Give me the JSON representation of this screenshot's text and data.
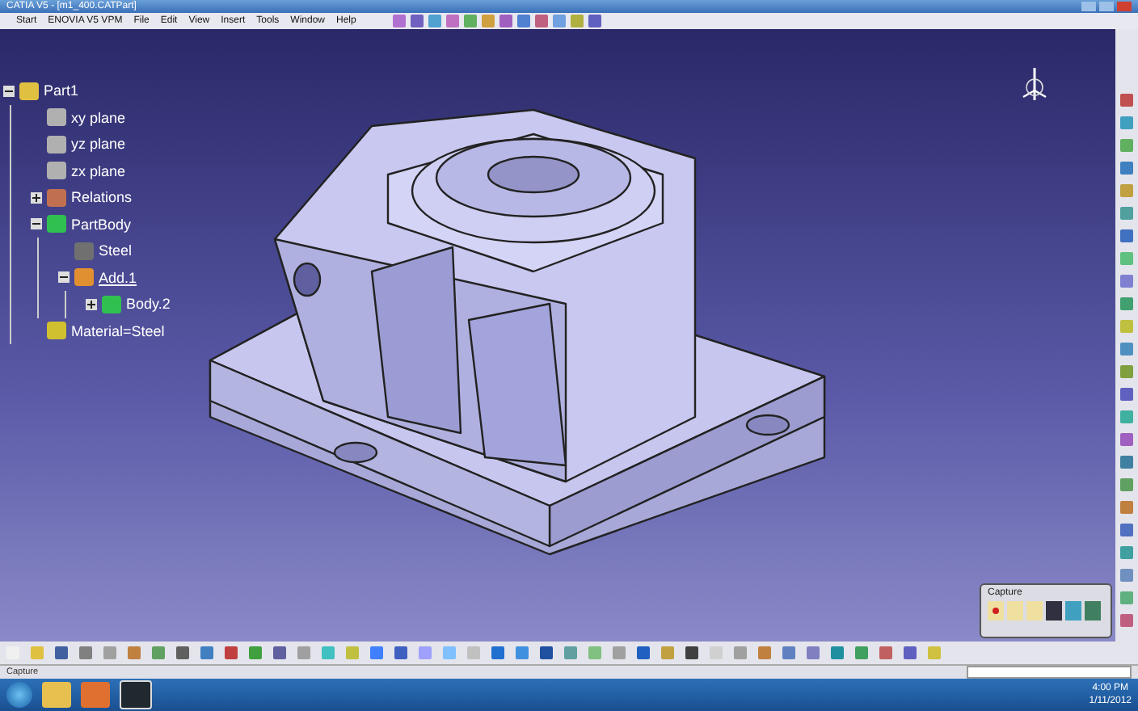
{
  "window": {
    "title": "CATIA V5 - [m1_400.CATPart]"
  },
  "menu": [
    "Start",
    "ENOVIA V5 VPM",
    "File",
    "Edit",
    "View",
    "Insert",
    "Tools",
    "Window",
    "Help"
  ],
  "tree": {
    "label": "Part1",
    "kind": "part",
    "expanded": true,
    "current": false,
    "children": [
      {
        "label": "xy plane",
        "kind": "plane",
        "current": false
      },
      {
        "label": "yz plane",
        "kind": "plane",
        "current": false
      },
      {
        "label": "zx plane",
        "kind": "plane",
        "current": false
      },
      {
        "label": "Relations",
        "kind": "relations",
        "expanded": false,
        "current": false
      },
      {
        "label": "PartBody",
        "kind": "body",
        "expanded": true,
        "current": false,
        "children": [
          {
            "label": "Steel",
            "kind": "material",
            "current": false
          },
          {
            "label": "Add.1",
            "kind": "operation",
            "expanded": true,
            "current": true,
            "children": [
              {
                "label": "Body.2",
                "kind": "body",
                "expanded": false,
                "current": false
              }
            ]
          }
        ]
      },
      {
        "label": "Material=Steel",
        "kind": "parameter",
        "current": false
      }
    ]
  },
  "capture_panel": {
    "title": "Capture"
  },
  "status_bar": {
    "text": "Capture"
  },
  "taskbar": {
    "time": "4:00 PM",
    "date": "1/11/2012"
  }
}
